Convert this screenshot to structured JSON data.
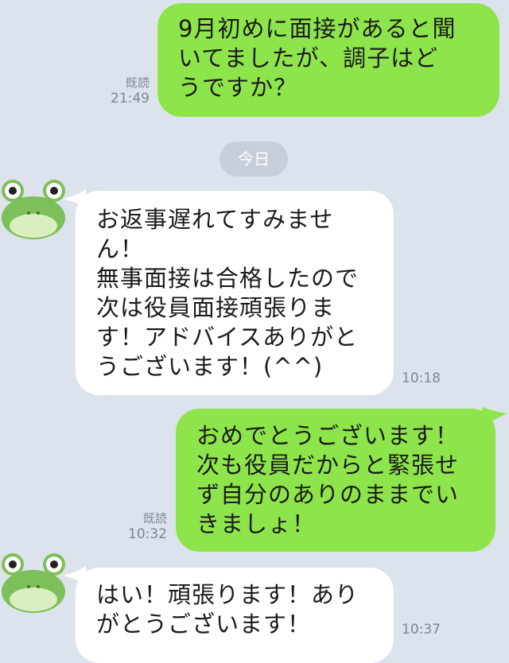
{
  "date_divider": "今日",
  "messages": [
    {
      "side": "out",
      "text": "9月初めに面接があると聞\nいてましたが、調子はど\nうですか？",
      "read": "既読",
      "time": "21:49"
    },
    {
      "side": "in",
      "text": "お返事遅れてすみませ\nん！\n無事面接は合格したので\n次は役員面接頑張りま\nす！アドバイスありがと\nうございます！(^^)",
      "time": "10:18"
    },
    {
      "side": "out",
      "text": "おめでとうございます！\n次も役員だからと緊張せ\nず自分のありのままでい\nきましょ！",
      "read": "既読",
      "time": "10:32"
    },
    {
      "side": "in",
      "text": "はい！頑張ります！あり\nがとうございます！",
      "time": "10:37"
    }
  ],
  "colors": {
    "background": "#dde3ec",
    "outgoing_bubble": "#8ee44b",
    "incoming_bubble": "#ffffff",
    "meta_text": "#7d8694"
  },
  "avatar_icon": "frog-avatar-icon"
}
